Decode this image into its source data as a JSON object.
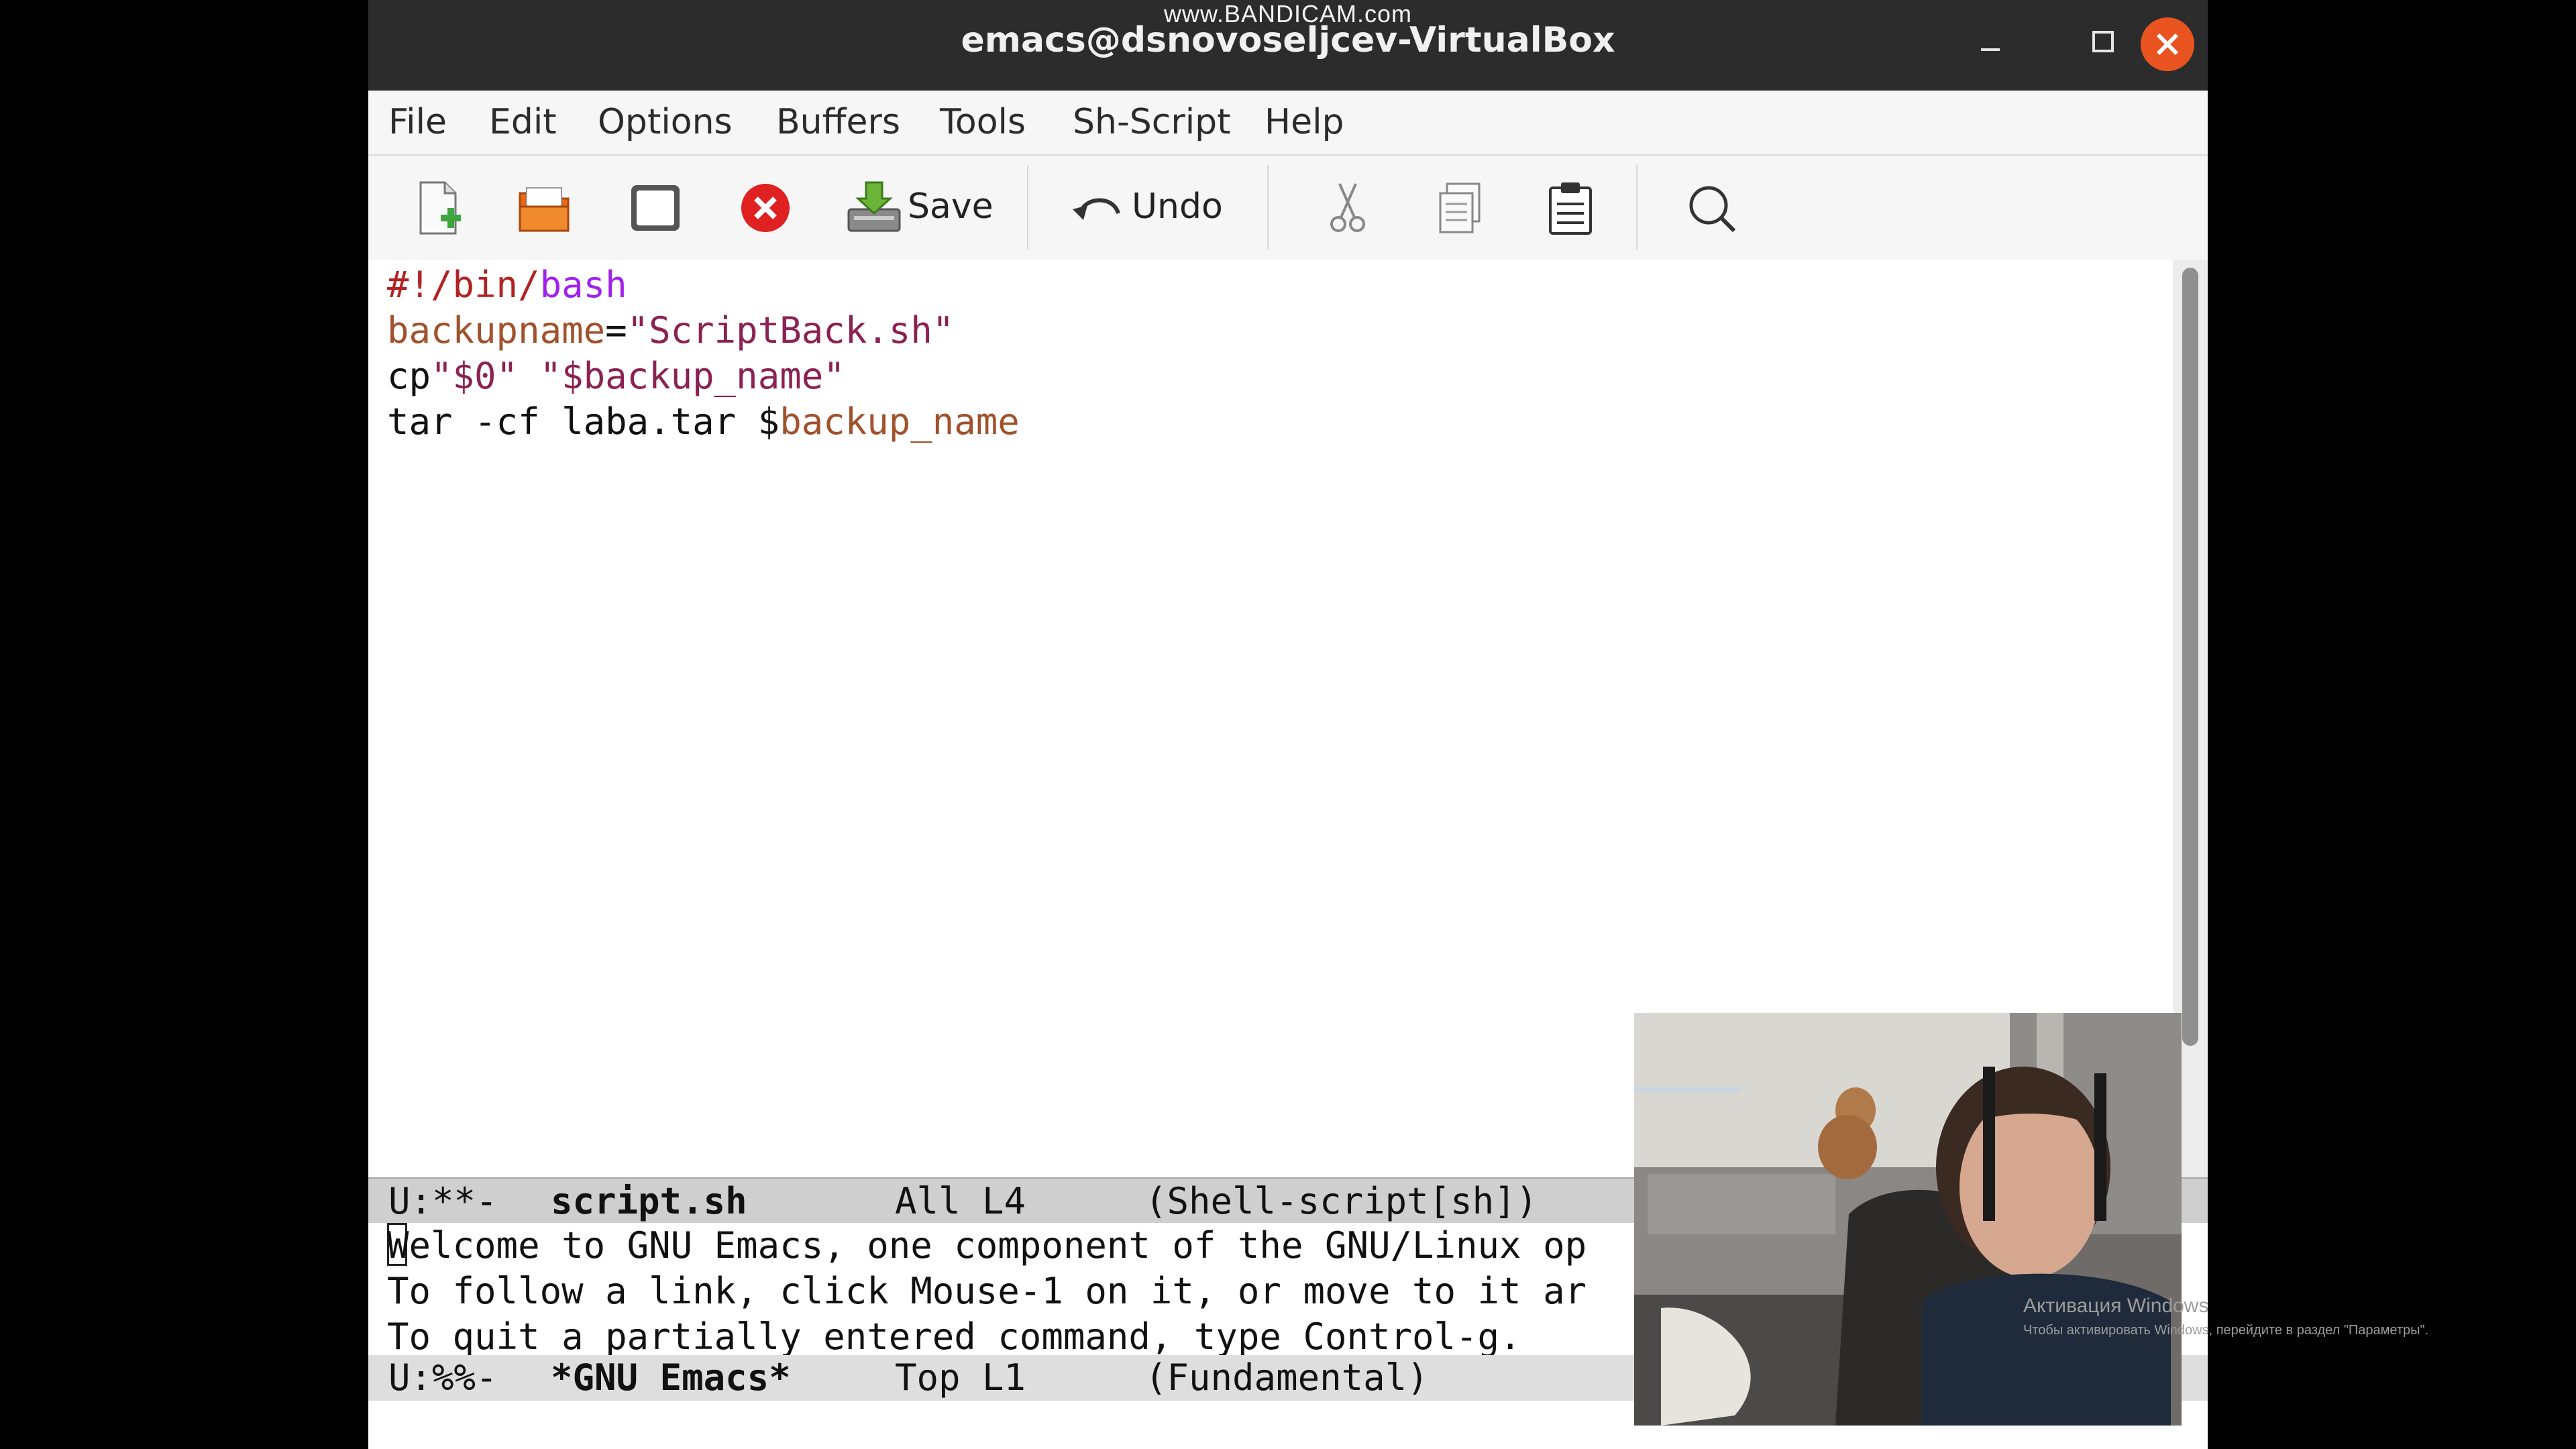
{
  "watermark": "www.BANDICAM.com",
  "window": {
    "title": "emacs@dsnovoseljcev-VirtualBox"
  },
  "menu": [
    "File",
    "Edit",
    "Options",
    "Buffers",
    "Tools",
    "Sh-Script",
    "Help"
  ],
  "toolbar": {
    "save_label": "Save",
    "undo_label": "Undo"
  },
  "code_lines": [
    [
      {
        "t": "#!/bin/",
        "c": "comment"
      },
      {
        "t": "bash",
        "c": "keyword"
      }
    ],
    [
      {
        "t": "backupname",
        "c": "var"
      },
      {
        "t": "=",
        "c": "plain"
      },
      {
        "t": "\"ScriptBack.sh\"",
        "c": "string"
      }
    ],
    [
      {
        "t": "cp",
        "c": "plain"
      },
      {
        "t": "\"$0\" \"$backup_name\"",
        "c": "string"
      }
    ],
    [
      {
        "t": "tar -cf laba.tar $",
        "c": "plain"
      },
      {
        "t": "backup_name",
        "c": "var"
      }
    ]
  ],
  "modeline_top": {
    "state": "U:**-",
    "buffer": "script.sh",
    "position": "All L4",
    "mode": "(Shell-script[sh])"
  },
  "welcome_lines": [
    "Welcome to GNU Emacs, one component of the GNU/Linux op",
    "To follow a link, click Mouse-1 on it, or move to it ar",
    "To quit a partially entered command, type Control-g."
  ],
  "modeline_bottom": {
    "state": "U:%%-",
    "buffer": "*GNU Emacs*",
    "position": "Top L1",
    "mode": "(Fundamental)"
  },
  "activation": {
    "title": "Активация Windows",
    "subtitle": "Чтобы активировать Windows, перейдите в раздел \"Параметры\"."
  },
  "colors": {
    "comment": "#b22222",
    "keyword": "#a020f0",
    "variable": "#a0522d",
    "string": "#8b2252",
    "close_button": "#e95420",
    "titlebar": "#2c2c2c"
  }
}
